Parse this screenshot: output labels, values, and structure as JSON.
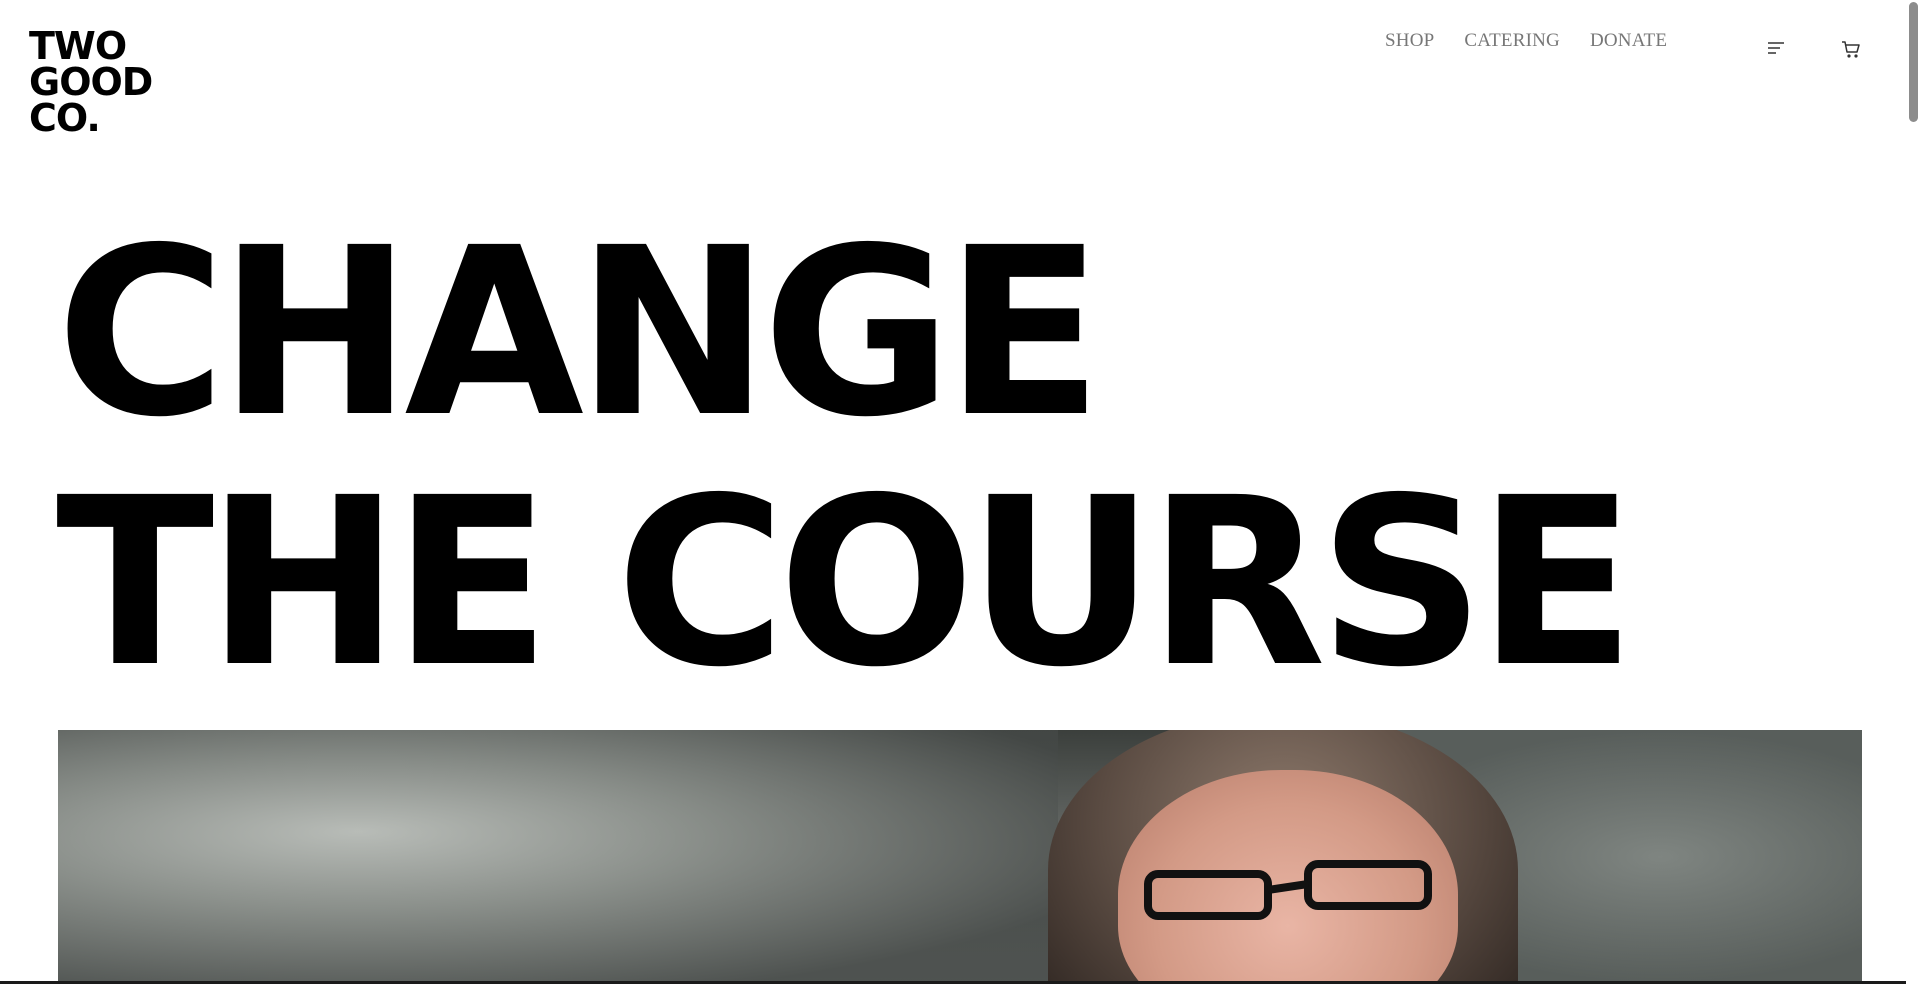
{
  "brand": {
    "logo_lines": [
      "TWO",
      "GOOD",
      "CO."
    ]
  },
  "nav": {
    "items": [
      {
        "label": "SHOP"
      },
      {
        "label": "CATERING"
      },
      {
        "label": "DONATE"
      }
    ],
    "menu_icon": "hamburger-menu-icon",
    "cart_icon": "cart-icon"
  },
  "hero": {
    "title_lines": [
      "CHANGE",
      "THE COURSE"
    ]
  },
  "media": {
    "type": "video",
    "subject_icon": "person-with-glasses"
  },
  "colors": {
    "text": "#000000",
    "nav_text": "#777777",
    "background": "#ffffff"
  }
}
